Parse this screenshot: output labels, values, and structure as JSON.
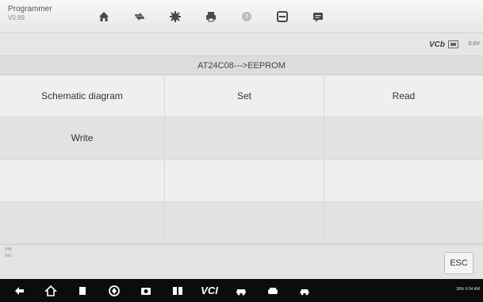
{
  "app": {
    "title": "Programmer",
    "version": "V0.99"
  },
  "toolbar": {
    "buttons": [
      "home-icon",
      "vehicle-swap-icon",
      "settings-icon",
      "print-icon",
      "help-icon",
      "save-icon",
      "message-icon"
    ]
  },
  "status": {
    "vci_label": "VCb",
    "voltage": "0.0V"
  },
  "page": {
    "title": "AT24C08--->EEPROM"
  },
  "grid": {
    "row1": [
      "Schematic diagram",
      "Set",
      "Read"
    ],
    "row2": [
      "Write",
      "",
      ""
    ],
    "row3": [
      "",
      "",
      ""
    ],
    "row4": [
      "",
      "",
      ""
    ]
  },
  "info": {
    "line1": "VIN:",
    "line2": "Info:"
  },
  "esc": {
    "label": "ESC"
  },
  "navbar": {
    "vci_label": "VCI",
    "status_text": "38% 6:04 AM"
  },
  "colors": {
    "toolbar_icon": "#4a4a4a",
    "help_icon": "#bdbdbd",
    "navbar_bg": "#0c0c0c"
  }
}
